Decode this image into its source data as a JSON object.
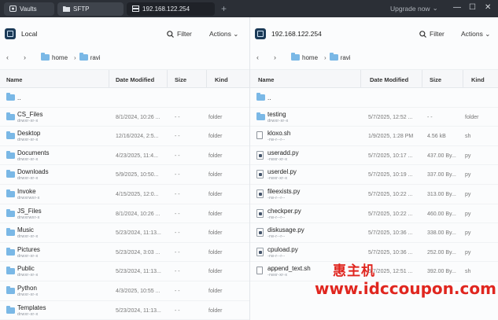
{
  "tabs": [
    {
      "label": "Vaults",
      "icon": "vault-icon"
    },
    {
      "label": "SFTP",
      "icon": "folder-icon"
    },
    {
      "label": "192.168.122.254",
      "icon": "server-icon"
    }
  ],
  "upgrade_label": "Upgrade now",
  "local": {
    "title": "Local",
    "filter_label": "Filter",
    "actions_label": "Actions",
    "path": [
      "home",
      "ravi"
    ],
    "columns": [
      "Name",
      "Date Modified",
      "Size",
      "Kind"
    ],
    "rows": [
      {
        "name": "..",
        "perm": "",
        "date": "",
        "size": "",
        "kind": "",
        "type": "folder"
      },
      {
        "name": "CS_Files",
        "perm": "drwxr-xr-x",
        "date": "8/1/2024, 10:26 ...",
        "size": "- -",
        "kind": "folder",
        "type": "folder"
      },
      {
        "name": "Desktop",
        "perm": "drwxr-xr-x",
        "date": "12/16/2024, 2:5...",
        "size": "- -",
        "kind": "folder",
        "type": "folder"
      },
      {
        "name": "Documents",
        "perm": "drwxr-xr-x",
        "date": "4/23/2025, 11:4...",
        "size": "- -",
        "kind": "folder",
        "type": "folder"
      },
      {
        "name": "Downloads",
        "perm": "drwxr-xr-x",
        "date": "5/9/2025, 10:50...",
        "size": "- -",
        "kind": "folder",
        "type": "folder"
      },
      {
        "name": "Invoke",
        "perm": "drwxrwxr-x",
        "date": "4/15/2025, 12:0...",
        "size": "- -",
        "kind": "folder",
        "type": "folder"
      },
      {
        "name": "JS_Files",
        "perm": "drwxrwxr-x",
        "date": "8/1/2024, 10:26 ...",
        "size": "- -",
        "kind": "folder",
        "type": "folder"
      },
      {
        "name": "Music",
        "perm": "drwxr-xr-x",
        "date": "5/23/2024, 11:13...",
        "size": "- -",
        "kind": "folder",
        "type": "folder"
      },
      {
        "name": "Pictures",
        "perm": "drwxr-xr-x",
        "date": "5/23/2024, 3:03 ...",
        "size": "- -",
        "kind": "folder",
        "type": "folder"
      },
      {
        "name": "Public",
        "perm": "drwxr-xr-x",
        "date": "5/23/2024, 11:13...",
        "size": "- -",
        "kind": "folder",
        "type": "folder"
      },
      {
        "name": "Python",
        "perm": "drwxr-xr-x",
        "date": "4/3/2025, 10:55 ...",
        "size": "- -",
        "kind": "folder",
        "type": "folder"
      },
      {
        "name": "Templates",
        "perm": "drwxr-xr-x",
        "date": "5/23/2024, 11:13...",
        "size": "- -",
        "kind": "folder",
        "type": "folder"
      }
    ]
  },
  "remote": {
    "title": "192.168.122.254",
    "filter_label": "Filter",
    "actions_label": "Actions",
    "path": [
      "home",
      "ravi"
    ],
    "columns": [
      "Name",
      "Date Modified",
      "Size",
      "Kind"
    ],
    "rows": [
      {
        "name": "..",
        "perm": "",
        "date": "",
        "size": "",
        "kind": "",
        "type": "folder"
      },
      {
        "name": "testing",
        "perm": "drwxr-xr-x",
        "date": "5/7/2025, 12:52 ...",
        "size": "- -",
        "kind": "folder",
        "type": "folder"
      },
      {
        "name": "kloxo.sh",
        "perm": "-rw-r--r--",
        "date": "1/9/2025, 1:28 PM",
        "size": "4.56 kB",
        "kind": "sh",
        "type": "doc"
      },
      {
        "name": "useradd.py",
        "perm": "-rwxr-xr-x",
        "date": "5/7/2025, 10:17 ...",
        "size": "437.00 By...",
        "kind": "py",
        "type": "py"
      },
      {
        "name": "userdel.py",
        "perm": "-rwxr-xr-x",
        "date": "5/7/2025, 10:19 ...",
        "size": "337.00 By...",
        "kind": "py",
        "type": "py"
      },
      {
        "name": "fileexists.py",
        "perm": "-rw-r--r--",
        "date": "5/7/2025, 10:22 ...",
        "size": "313.00 By...",
        "kind": "py",
        "type": "py"
      },
      {
        "name": "checkper.py",
        "perm": "-rw-r--r--",
        "date": "5/7/2025, 10:22 ...",
        "size": "460.00 By...",
        "kind": "py",
        "type": "py"
      },
      {
        "name": "diskusage.py",
        "perm": "-rw-r--r--",
        "date": "5/7/2025, 10:36 ...",
        "size": "338.00 By...",
        "kind": "py",
        "type": "py"
      },
      {
        "name": "cpuload.py",
        "perm": "-rw-r--r--",
        "date": "5/7/2025, 10:36 ...",
        "size": "252.00 By...",
        "kind": "py",
        "type": "py"
      },
      {
        "name": "append_text.sh",
        "perm": "-rwxr-xr-x",
        "date": "5/7/2025, 12:51 ...",
        "size": "392.00 By...",
        "kind": "sh",
        "type": "doc"
      }
    ]
  },
  "watermark": {
    "line1": "惠主机",
    "line2": "www.idccoupon.com"
  }
}
